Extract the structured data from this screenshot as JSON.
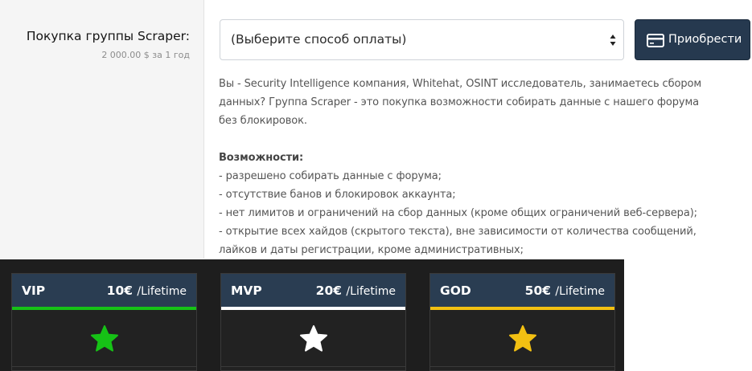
{
  "purchase": {
    "group_label": "Покупка группы Scraper:",
    "price_line": "2 000.00 $ за 1 год",
    "payment_select": "(Выберите способ оплаты)",
    "buy_button": "Приобрести",
    "buy_icon": "credit-card-icon"
  },
  "description": {
    "lines": [
      "Вы - Security Intelligence компания, Whitehat, OSINT исследователь, занимаетесь сбором",
      "данных? Группа Scraper - это покупка возможности собирать данные с нашего форума",
      "без блокировок."
    ],
    "features_title": "Возможности:",
    "features": [
      "- разрешено собирать данные с форума;",
      "- отсутствие банов и блокировок аккаунта;",
      "- нет лимитов и ограничений на сбор данных (кроме общих ограничений веб-сервера);",
      "- открытие всех хайдов (скрытого текста), вне зависимости от количества сообщений,",
      "лайков и даты регистрации, кроме административных;"
    ]
  },
  "plans": [
    {
      "name": "VIP",
      "price": "10€",
      "period": "/Lifetime",
      "color": "#16c216",
      "icon": "star-icon"
    },
    {
      "name": "MVP",
      "price": "20€",
      "period": "/Lifetime",
      "color": "#ffffff",
      "icon": "star-icon"
    },
    {
      "name": "GOD",
      "price": "50€",
      "period": "/Lifetime",
      "color": "#f2c012",
      "icon": "star-icon"
    }
  ]
}
